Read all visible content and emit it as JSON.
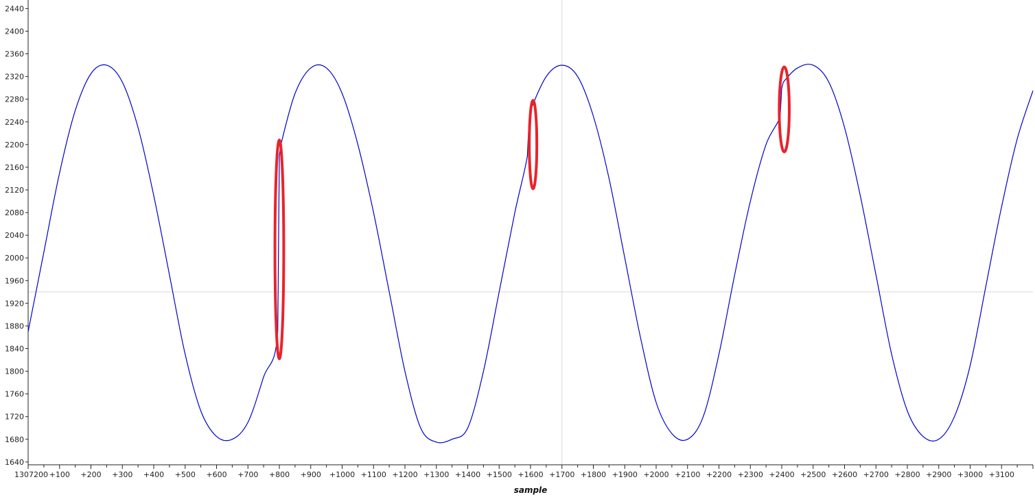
{
  "chart_data": {
    "type": "line",
    "xlabel": "sample",
    "ylabel": "",
    "x_start_label": "1307200",
    "xlim": [
      0,
      3200
    ],
    "ylim": [
      1635,
      2455
    ],
    "y_ticks": [
      1640,
      1680,
      1720,
      1760,
      1800,
      1840,
      1880,
      1920,
      1960,
      2000,
      2040,
      2080,
      2120,
      2160,
      2200,
      2240,
      2280,
      2320,
      2360,
      2400,
      2440
    ],
    "x_tick_labels": [
      "1307200",
      "+100",
      "+200",
      "+300",
      "+400",
      "+500",
      "+600",
      "+700",
      "+800",
      "+900",
      "+1000",
      "+1100",
      "+1200",
      "+1300",
      "+1400",
      "+1500",
      "+1600",
      "+1700",
      "+1800",
      "+1900",
      "+2000",
      "+2100",
      "+2200",
      "+2300",
      "+2400",
      "+2500",
      "+2600",
      "+2700",
      "+2800",
      "+2900",
      "+3000",
      "+3100"
    ],
    "x_tick_values": [
      0,
      100,
      200,
      300,
      400,
      500,
      600,
      700,
      800,
      900,
      1000,
      1100,
      1200,
      1300,
      1400,
      1500,
      1600,
      1700,
      1800,
      1900,
      2000,
      2100,
      2200,
      2300,
      2400,
      2500,
      2600,
      2700,
      2800,
      2900,
      3000,
      3100
    ],
    "grid": false,
    "crosshair": {
      "x": 1700,
      "y": 1940
    },
    "series": [
      {
        "color": "#0000cc",
        "x": [
          0,
          50,
          100,
          150,
          200,
          250,
          300,
          350,
          400,
          450,
          500,
          550,
          600,
          650,
          700,
          750,
          795,
          800,
          805,
          850,
          900,
          950,
          1000,
          1050,
          1100,
          1150,
          1200,
          1250,
          1300,
          1350,
          1400,
          1450,
          1500,
          1550,
          1590,
          1595,
          1600,
          1650,
          1700,
          1750,
          1800,
          1850,
          1900,
          1950,
          2000,
          2050,
          2100,
          2150,
          2200,
          2250,
          2300,
          2350,
          2395,
          2400,
          2405,
          2450,
          2500,
          2550,
          2600,
          2650,
          2700,
          2750,
          2800,
          2850,
          2900,
          2950,
          3000,
          3050,
          3100,
          3150,
          3200
        ],
        "values": [
          1870,
          2010,
          2150,
          2260,
          2325,
          2340,
          2310,
          2230,
          2110,
          1970,
          1830,
          1730,
          1685,
          1680,
          1710,
          1790,
          1870,
          2180,
          2200,
          2290,
          2335,
          2335,
          2290,
          2200,
          2080,
          1940,
          1800,
          1700,
          1675,
          1680,
          1700,
          1800,
          1940,
          2080,
          2180,
          2240,
          2260,
          2320,
          2340,
          2320,
          2250,
          2140,
          2000,
          1860,
          1745,
          1690,
          1680,
          1720,
          1830,
          1970,
          2100,
          2200,
          2250,
          2300,
          2310,
          2335,
          2340,
          2310,
          2230,
          2110,
          1970,
          1830,
          1730,
          1685,
          1680,
          1720,
          1810,
          1950,
          2090,
          2210,
          2295
        ]
      }
    ],
    "annotations": [
      {
        "type": "ellipse",
        "color": "#e8242b",
        "cx": 800,
        "cy": 2015,
        "rx": 14,
        "ry": 193
      },
      {
        "type": "ellipse",
        "color": "#e8242b",
        "cx": 1608,
        "cy": 2200,
        "rx": 12,
        "ry": 78
      },
      {
        "type": "ellipse",
        "color": "#e8242b",
        "cx": 2408,
        "cy": 2262,
        "rx": 16,
        "ry": 75
      }
    ]
  }
}
